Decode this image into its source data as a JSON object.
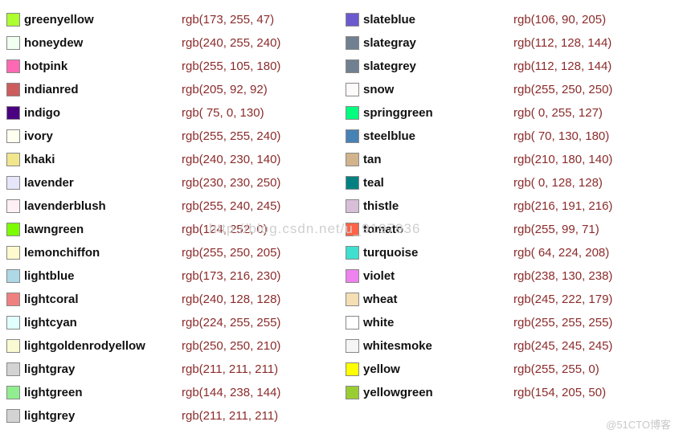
{
  "watermark_center": "http://blog.csdn.net/u_9197936",
  "watermark_corner": "@51CTO博客",
  "left": [
    {
      "name": "greenyellow",
      "hex": "#ADFF2F",
      "rgb": "rgb(173, 255, 47)"
    },
    {
      "name": "honeydew",
      "hex": "#F0FFF0",
      "rgb": "rgb(240, 255, 240)"
    },
    {
      "name": "hotpink",
      "hex": "#FF69B4",
      "rgb": "rgb(255, 105, 180)"
    },
    {
      "name": "indianred",
      "hex": "#CD5C5C",
      "rgb": "rgb(205, 92, 92)"
    },
    {
      "name": "indigo",
      "hex": "#4B0082",
      "rgb": "rgb( 75, 0, 130)"
    },
    {
      "name": "ivory",
      "hex": "#FFFFF0",
      "rgb": "rgb(255, 255, 240)"
    },
    {
      "name": "khaki",
      "hex": "#F0E68C",
      "rgb": "rgb(240, 230, 140)"
    },
    {
      "name": "lavender",
      "hex": "#E6E6FA",
      "rgb": "rgb(230, 230, 250)"
    },
    {
      "name": "lavenderblush",
      "hex": "#FFF0F5",
      "rgb": "rgb(255, 240, 245)"
    },
    {
      "name": "lawngreen",
      "hex": "#7CFC00",
      "rgb": "rgb(124, 252, 0)"
    },
    {
      "name": "lemonchiffon",
      "hex": "#FFFACD",
      "rgb": "rgb(255, 250, 205)"
    },
    {
      "name": "lightblue",
      "hex": "#ADD8E6",
      "rgb": "rgb(173, 216, 230)"
    },
    {
      "name": "lightcoral",
      "hex": "#F08080",
      "rgb": "rgb(240, 128, 128)"
    },
    {
      "name": "lightcyan",
      "hex": "#E0FFFF",
      "rgb": "rgb(224, 255, 255)"
    },
    {
      "name": "lightgoldenrodyellow",
      "hex": "#FAFAD2",
      "rgb": "rgb(250, 250, 210)"
    },
    {
      "name": "lightgray",
      "hex": "#D3D3D3",
      "rgb": "rgb(211, 211, 211)"
    },
    {
      "name": "lightgreen",
      "hex": "#90EE90",
      "rgb": "rgb(144, 238, 144)"
    },
    {
      "name": "lightgrey",
      "hex": "#D3D3D3",
      "rgb": "rgb(211, 211, 211)"
    }
  ],
  "right": [
    {
      "name": "slateblue",
      "hex": "#6A5ACD",
      "rgb": "rgb(106, 90, 205)"
    },
    {
      "name": "slategray",
      "hex": "#708090",
      "rgb": "rgb(112, 128, 144)"
    },
    {
      "name": "slategrey",
      "hex": "#708090",
      "rgb": "rgb(112, 128, 144)"
    },
    {
      "name": "snow",
      "hex": "#FFFAFA",
      "rgb": "rgb(255, 250, 250)"
    },
    {
      "name": "springgreen",
      "hex": "#00FF7F",
      "rgb": "rgb( 0, 255, 127)"
    },
    {
      "name": "steelblue",
      "hex": "#4682B4",
      "rgb": "rgb( 70, 130, 180)"
    },
    {
      "name": "tan",
      "hex": "#D2B48C",
      "rgb": "rgb(210, 180, 140)"
    },
    {
      "name": "teal",
      "hex": "#008080",
      "rgb": "rgb( 0, 128, 128)"
    },
    {
      "name": "thistle",
      "hex": "#D8BFD8",
      "rgb": "rgb(216, 191, 216)"
    },
    {
      "name": "tomato",
      "hex": "#FF6347",
      "rgb": "rgb(255, 99, 71)"
    },
    {
      "name": "turquoise",
      "hex": "#40E0D0",
      "rgb": "rgb( 64, 224, 208)"
    },
    {
      "name": "violet",
      "hex": "#EE82EE",
      "rgb": "rgb(238, 130, 238)"
    },
    {
      "name": "wheat",
      "hex": "#F5DEB3",
      "rgb": "rgb(245, 222, 179)"
    },
    {
      "name": "white",
      "hex": "#FFFFFF",
      "rgb": "rgb(255, 255, 255)"
    },
    {
      "name": "whitesmoke",
      "hex": "#F5F5F5",
      "rgb": "rgb(245, 245, 245)"
    },
    {
      "name": "yellow",
      "hex": "#FFFF00",
      "rgb": "rgb(255, 255, 0)"
    },
    {
      "name": "yellowgreen",
      "hex": "#9ACD32",
      "rgb": "rgb(154, 205, 50)"
    }
  ]
}
